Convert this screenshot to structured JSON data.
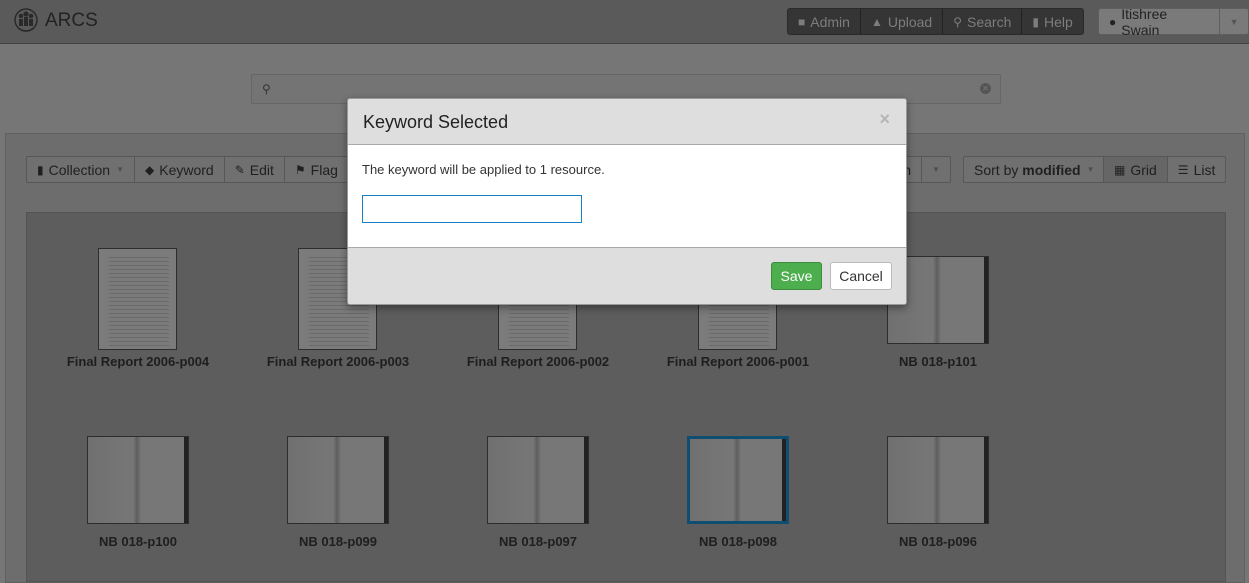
{
  "app": {
    "title": "ARCS"
  },
  "nav": {
    "items": [
      {
        "label": "Admin",
        "icon": "lock-icon"
      },
      {
        "label": "Upload",
        "icon": "upload-icon"
      },
      {
        "label": "Search",
        "icon": "search-icon"
      },
      {
        "label": "Help",
        "icon": "book-icon"
      }
    ],
    "user": "Itishree Swain"
  },
  "search": {
    "value": ""
  },
  "toolbar": {
    "collection": "Collection",
    "keyword": "Keyword",
    "edit": "Edit",
    "flag": "Flag",
    "hidden_tail": "n",
    "sort_prefix": "Sort by ",
    "sort_value": "modified",
    "grid": "Grid",
    "list": "List"
  },
  "items": [
    {
      "name": "Final Report 2006-p004",
      "type": "page"
    },
    {
      "name": "Final Report 2006-p003",
      "type": "page"
    },
    {
      "name": "Final Report 2006-p002",
      "type": "page"
    },
    {
      "name": "Final Report 2006-p001",
      "type": "page"
    },
    {
      "name": "NB 018-p101",
      "type": "notebook"
    },
    {
      "name": "NB 018-p100",
      "type": "notebook"
    },
    {
      "name": "NB 018-p099",
      "type": "notebook"
    },
    {
      "name": "NB 018-p097",
      "type": "notebook"
    },
    {
      "name": "NB 018-p098",
      "type": "notebook",
      "selected": true
    },
    {
      "name": "NB 018-p096",
      "type": "notebook"
    }
  ],
  "modal": {
    "title": "Keyword Selected",
    "message": "The keyword will be applied to 1 resource.",
    "input_value": "",
    "save": "Save",
    "cancel": "Cancel"
  },
  "colors": {
    "save": "#4cae4c",
    "selected_border": "#0f4e70",
    "input_focus": "#1a7ec2"
  }
}
